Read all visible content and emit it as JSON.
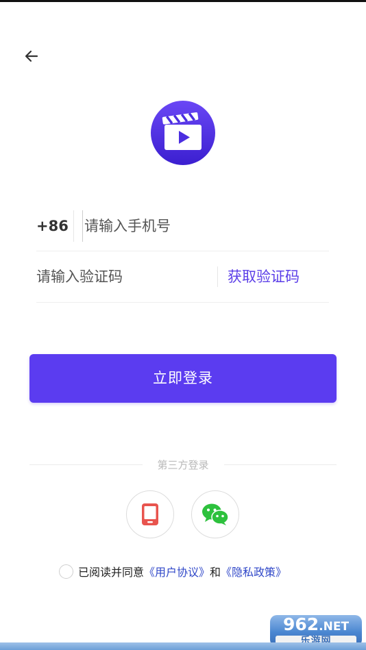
{
  "login": {
    "country_code": "+86",
    "phone_placeholder": "请输入手机号",
    "code_placeholder": "请输入验证码",
    "get_code_label": "获取验证码",
    "login_button": "立即登录"
  },
  "third_party": {
    "label": "第三方登录",
    "options": [
      "phone-icon",
      "wechat-icon"
    ]
  },
  "agreement": {
    "prefix": "已阅读并同意",
    "user_agreement": "《用户协议》",
    "conjunction": "和",
    "privacy_policy": "《隐私政策》"
  },
  "watermark": {
    "top_text": "962",
    "top_suffix": ".NET",
    "bottom_text": "乐游网"
  },
  "colors": {
    "accent": "#5b3cf0",
    "link": "#2f47c8",
    "logo_gradient_start": "#6a47f5",
    "logo_gradient_end": "#3b1fd0"
  }
}
